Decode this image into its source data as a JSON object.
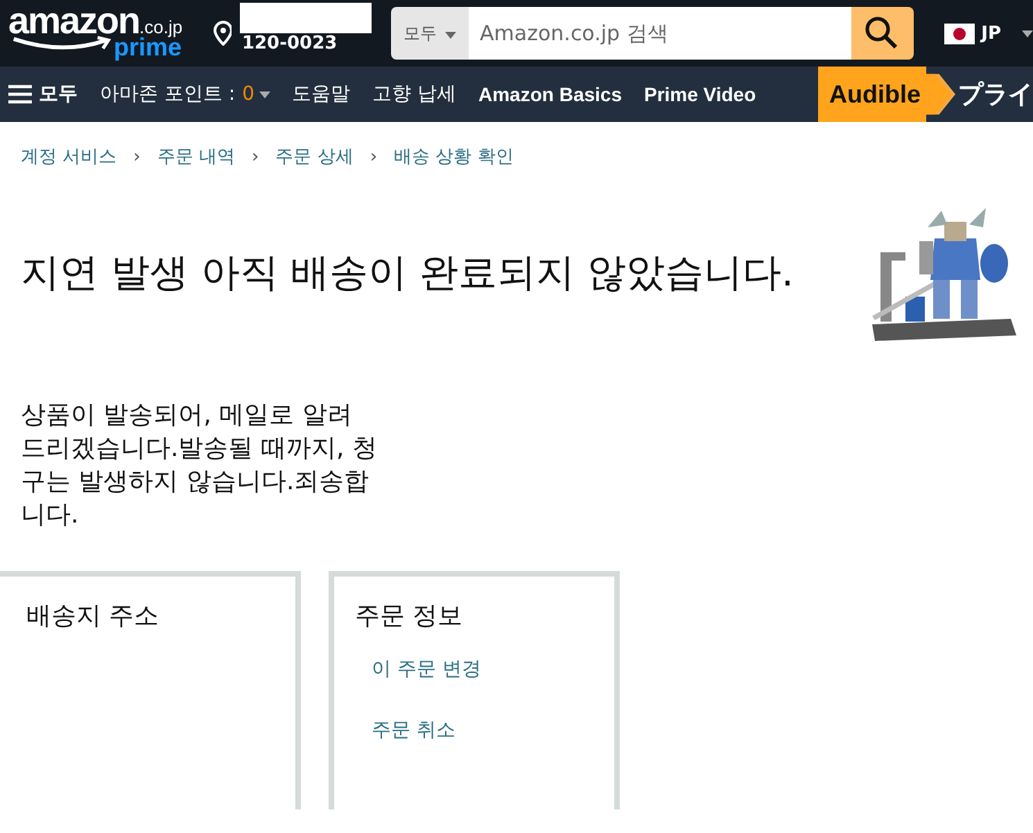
{
  "header": {
    "logo": "amazon",
    "logo_domain": ".co.jp",
    "logo_sub": "prime",
    "postal_code": "120-0023",
    "search": {
      "category": "모두",
      "placeholder": "Amazon.co.jp 검색"
    },
    "language": "JP"
  },
  "nav": {
    "menu_label": "모두",
    "items": [
      {
        "label": "아마존 포인트 : ",
        "count": "0"
      },
      {
        "label": "도움말"
      },
      {
        "label": "고향 납세"
      },
      {
        "label": "Amazon Basics"
      },
      {
        "label": "Prime Video"
      }
    ],
    "promo": "Audible",
    "promo_after": "プライ"
  },
  "breadcrumb": [
    "계정 서비스",
    "주문 내역",
    "주문 상세",
    "배송 상황 확인"
  ],
  "separator": "›",
  "heading": "지연 발생 아직 배송이 완료되지 않았습니다.",
  "product_image": {
    "kind": "picture"
  },
  "message": "상품이 발송되어, 메일로 알려 드리겠습니다.발송될 때까지, 청구는 발생하지 않습니다.죄송합니다.",
  "panels": [
    {
      "title": "배송지 주소"
    },
    {
      "title": "주문 정보",
      "links": [
        "이 주문 변경",
        "주문 취소"
      ]
    }
  ]
}
